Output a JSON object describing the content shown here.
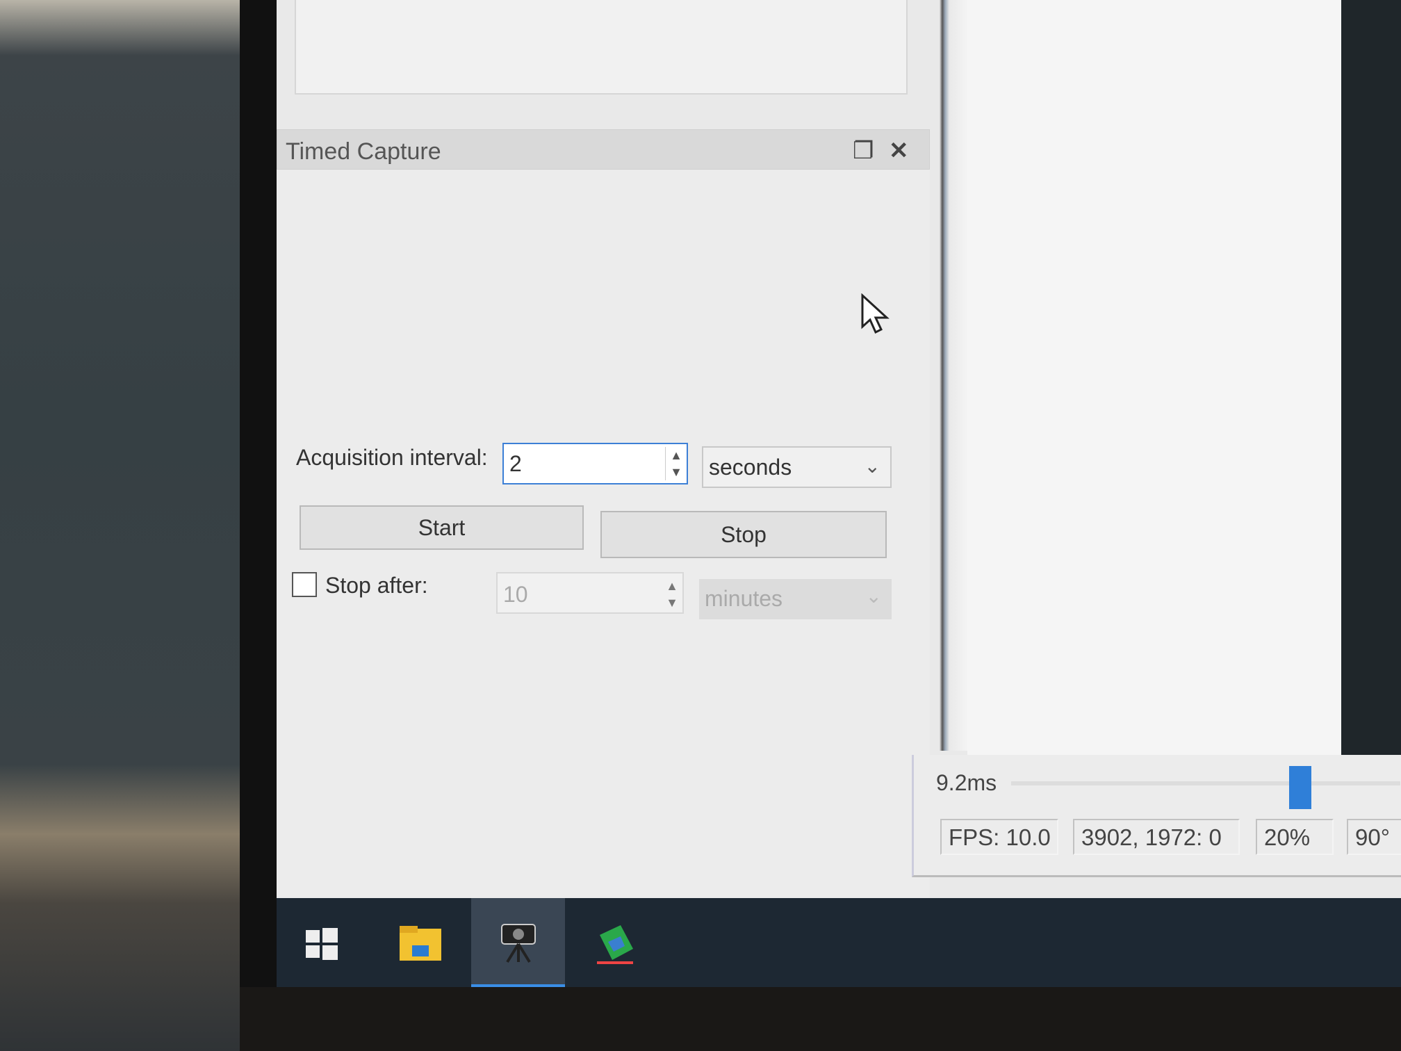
{
  "panel": {
    "title": "Timed Capture",
    "restore_icon": "restore-window-icon",
    "close_icon": "close-icon",
    "acquisition_label": "Acquisition interval:",
    "interval_value": "2",
    "interval_unit": "seconds",
    "start_label": "Start",
    "stop_label": "Stop",
    "stop_after_label": "Stop after:",
    "stop_after_checked": false,
    "stop_after_value": "10",
    "stop_after_unit": "minutes"
  },
  "viewer": {
    "exposure": "9.2ms",
    "fps": "FPS: 10.0",
    "cursor_info": "3902, 1972: 0",
    "zoom": "20%",
    "rotation": "90°"
  },
  "taskbar": {
    "items": [
      "start-windows-icon",
      "file-explorer-icon",
      "camera-app-icon",
      "app-icon"
    ],
    "active_index": 2,
    "accent": "#3a8ee6"
  }
}
